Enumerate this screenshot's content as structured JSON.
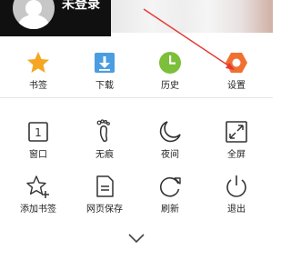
{
  "header": {
    "login_text": "未登录"
  },
  "row1": [
    {
      "label": "书签",
      "icon": "star-icon",
      "color": "#f5a623"
    },
    {
      "label": "下载",
      "icon": "download-icon",
      "color": "#4a9de0"
    },
    {
      "label": "历史",
      "icon": "history-clock-icon",
      "color": "#7cbf3a"
    },
    {
      "label": "设置",
      "icon": "settings-gear-icon",
      "color": "#f07030"
    }
  ],
  "row2": [
    {
      "label": "窗口",
      "icon": "window-count-icon",
      "value": "1"
    },
    {
      "label": "无痕",
      "icon": "footprint-icon"
    },
    {
      "label": "夜间",
      "icon": "moon-icon"
    },
    {
      "label": "全屏",
      "icon": "fullscreen-icon"
    }
  ],
  "row3": [
    {
      "label": "添加书签",
      "icon": "add-bookmark-icon"
    },
    {
      "label": "网页保存",
      "icon": "save-page-icon"
    },
    {
      "label": "刷新",
      "icon": "refresh-icon"
    },
    {
      "label": "退出",
      "icon": "power-icon"
    }
  ],
  "footer": {
    "icon": "chevron-down-icon"
  },
  "annotation": {
    "icon": "red-arrow-icon",
    "color": "#e53935"
  }
}
